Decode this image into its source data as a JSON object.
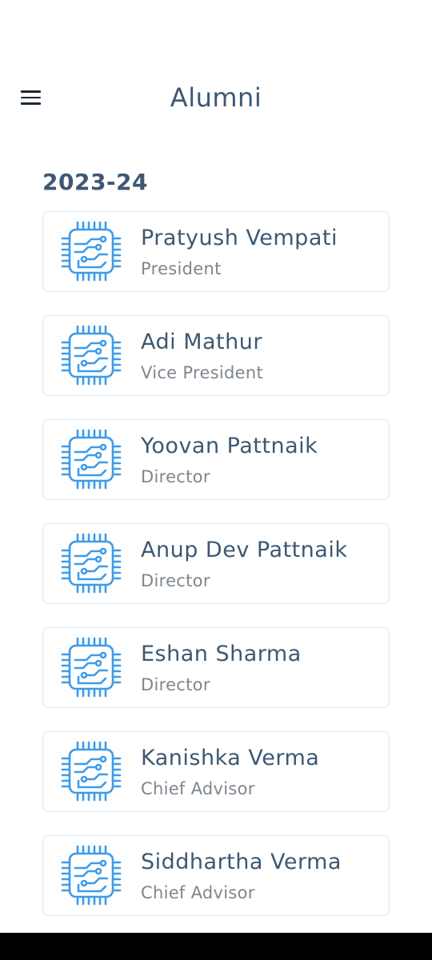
{
  "header": {
    "title": "Alumni",
    "menu_icon": "menu-icon"
  },
  "section": {
    "year": "2023-24"
  },
  "members": [
    {
      "name": "Pratyush Vempati",
      "role": "President",
      "icon": "circuit-chip-icon"
    },
    {
      "name": "Adi Mathur",
      "role": "Vice President",
      "icon": "circuit-chip-icon"
    },
    {
      "name": "Yoovan Pattnaik",
      "role": "Director",
      "icon": "circuit-chip-icon"
    },
    {
      "name": "Anup Dev Pattnaik",
      "role": "Director",
      "icon": "circuit-chip-icon"
    },
    {
      "name": "Eshan Sharma",
      "role": "Director",
      "icon": "circuit-chip-icon"
    },
    {
      "name": "Kanishka Verma",
      "role": "Chief Advisor",
      "icon": "circuit-chip-icon"
    },
    {
      "name": "Siddhartha Verma",
      "role": "Chief Advisor",
      "icon": "circuit-chip-icon"
    }
  ],
  "colors": {
    "title": "#3d5873",
    "subtitle": "#7e868e",
    "icon_blue": "#3d9be9",
    "card_border": "#dde9f3"
  }
}
